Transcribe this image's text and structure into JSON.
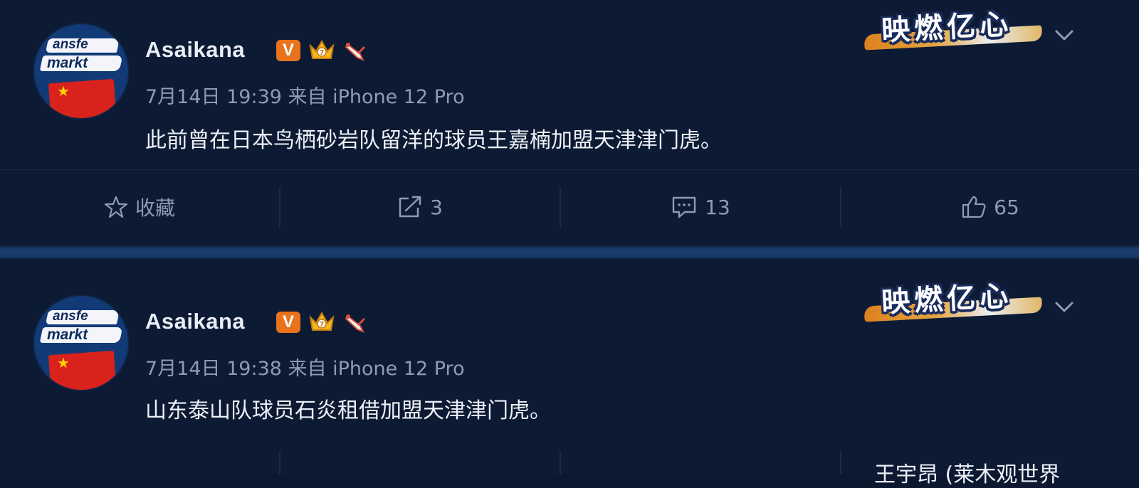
{
  "posts": [
    {
      "username": "Asaikana",
      "avatar_logo": [
        "ansfe",
        "markt"
      ],
      "meta": "7月14日 19:39 来自 iPhone 12 Pro",
      "content": "此前曾在日本鸟栖砂岩队留洋的球员王嘉楠加盟天津津门虎。",
      "sticker_text": "映燃亿心",
      "actions": {
        "favorite": "收藏",
        "repost": "3",
        "comment": "13",
        "like": "65"
      }
    },
    {
      "username": "Asaikana",
      "avatar_logo": [
        "ansfe",
        "markt"
      ],
      "meta": "7月14日 19:38 来自 iPhone 12 Pro",
      "content": "山东泰山队球员石炎租借加盟天津津门虎。",
      "sticker_text": "映燃亿心"
    }
  ],
  "cut_off_text": "王宇昂 (莱木观世界",
  "colors": {
    "background": "#0c1a33",
    "separator": "#1b3f73",
    "verified_badge": "#e8731a",
    "muted_text": "#8f9bb0"
  },
  "icons": {
    "verified": "v-badge-icon",
    "crown": "crown-icon",
    "pen": "pen-icon",
    "favorite": "star-icon",
    "repost": "repost-icon",
    "comment": "comment-icon",
    "like": "thumbs-up-icon",
    "menu": "chevron-down-icon"
  }
}
